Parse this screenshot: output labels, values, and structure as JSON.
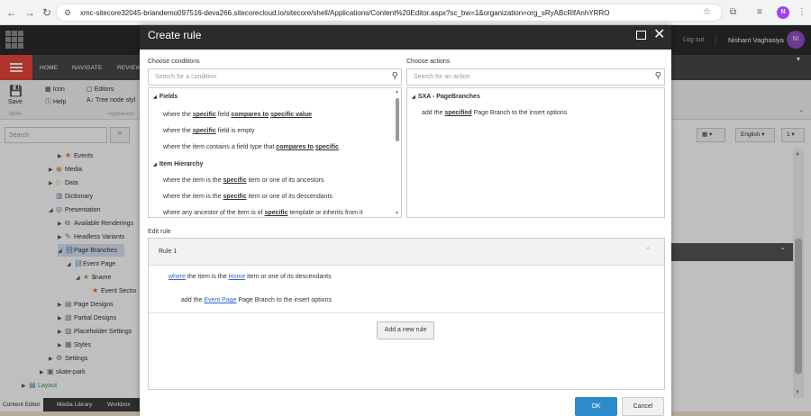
{
  "browser": {
    "url": "xmc-sitecore32045-briandemo097516-deva266.sitecorecloud.io/sitecore/shell/Applications/Content%20Editor.aspx?sc_bw=1&organization=org_sRyABcRlfAnhYRRO",
    "profile_initial": "N"
  },
  "app": {
    "logout": "Log out",
    "separator": "|",
    "user_name": "Nishant Vaghasiya",
    "user_initials": "NI",
    "ribbon_tabs": [
      "HOME",
      "NAVIGATE",
      "REVIEW"
    ],
    "ribbon": {
      "save": "Save",
      "write": "Write",
      "icon": "Icon",
      "help": "Help",
      "editors": "Editors",
      "tree_node_style": "Tree node styl",
      "appearance": "Appearanc"
    },
    "search_placeholder": "Search",
    "tree": [
      {
        "label": "Events",
        "icon": "star-icon"
      },
      {
        "label": "Media",
        "icon": "media-icon"
      },
      {
        "label": "Data",
        "icon": "data-icon"
      },
      {
        "label": "Dictionary",
        "icon": "dictionary-icon"
      },
      {
        "label": "Presentation",
        "icon": "presentation-icon"
      },
      {
        "label": "Available Renderings",
        "icon": "renderings-icon"
      },
      {
        "label": "Headless Variants",
        "icon": "variants-icon"
      },
      {
        "label": "Page Branches",
        "icon": "branch-icon"
      },
      {
        "label": "Event Page",
        "icon": "branch-icon"
      },
      {
        "label": "$name",
        "icon": "star-icon"
      },
      {
        "label": "Event Sectio",
        "icon": "star-icon"
      },
      {
        "label": "Page Designs",
        "icon": "designs-icon"
      },
      {
        "label": "Partial Designs",
        "icon": "partial-icon"
      },
      {
        "label": "Placeholder Settings",
        "icon": "placeholder-icon"
      },
      {
        "label": "Styles",
        "icon": "styles-icon"
      },
      {
        "label": "Settings",
        "icon": "settings-icon"
      },
      {
        "label": "skate-park",
        "icon": "site-icon"
      },
      {
        "label": "Layout",
        "icon": "layout-icon"
      }
    ],
    "bottom_tabs": [
      "Content Editor",
      "Media Library",
      "Workbox"
    ],
    "right_controls": {
      "language": "English",
      "version": "1"
    }
  },
  "dialog": {
    "title": "Create rule",
    "conditions": {
      "label": "Choose conditions",
      "placeholder": "Search for a condition",
      "groups": [
        {
          "name": "Fields",
          "items": [
            {
              "parts": [
                {
                  "t": "where the "
                },
                {
                  "k": "specific"
                },
                {
                  "t": " field "
                },
                {
                  "k": "compares to"
                },
                {
                  "t": " "
                },
                {
                  "k": "specific value"
                }
              ]
            },
            {
              "parts": [
                {
                  "t": "where the "
                },
                {
                  "k": "specific"
                },
                {
                  "t": " field is empty"
                }
              ]
            },
            {
              "parts": [
                {
                  "t": "where the item contains a field type that "
                },
                {
                  "k": "compares to"
                },
                {
                  "t": " "
                },
                {
                  "k": "specific"
                }
              ]
            }
          ]
        },
        {
          "name": "Item Hierarchy",
          "items": [
            {
              "parts": [
                {
                  "t": "where the item is the "
                },
                {
                  "k": "specific"
                },
                {
                  "t": " item or one of its ancestors"
                }
              ]
            },
            {
              "parts": [
                {
                  "t": "where the item is the "
                },
                {
                  "k": "specific"
                },
                {
                  "t": " item or one of its descendants"
                }
              ]
            },
            {
              "parts": [
                {
                  "t": "where any ancestor of the item is of "
                },
                {
                  "k": "specific"
                },
                {
                  "t": " template or inherits from it"
                }
              ]
            }
          ]
        }
      ]
    },
    "actions": {
      "label": "Choose actions",
      "placeholder": "Search for an action",
      "groups": [
        {
          "name": "SXA - PageBranches",
          "items": [
            {
              "parts": [
                {
                  "t": "add the "
                },
                {
                  "k": "specified"
                },
                {
                  "t": " Page Branch to the insert options"
                }
              ]
            }
          ]
        }
      ]
    },
    "edit_rule": {
      "label": "Edit rule",
      "rule_title": "Rule 1",
      "condition_line": [
        {
          "l": "where"
        },
        {
          "t": " the item is the "
        },
        {
          "l": "Home"
        },
        {
          "t": " item or one of its descendants"
        }
      ],
      "action_line": [
        {
          "t": "add the "
        },
        {
          "l": "Event Page"
        },
        {
          "t": " Page Branch to the insert options"
        }
      ],
      "add_button": "Add a new rule"
    },
    "ok": "OK",
    "cancel": "Cancel"
  }
}
